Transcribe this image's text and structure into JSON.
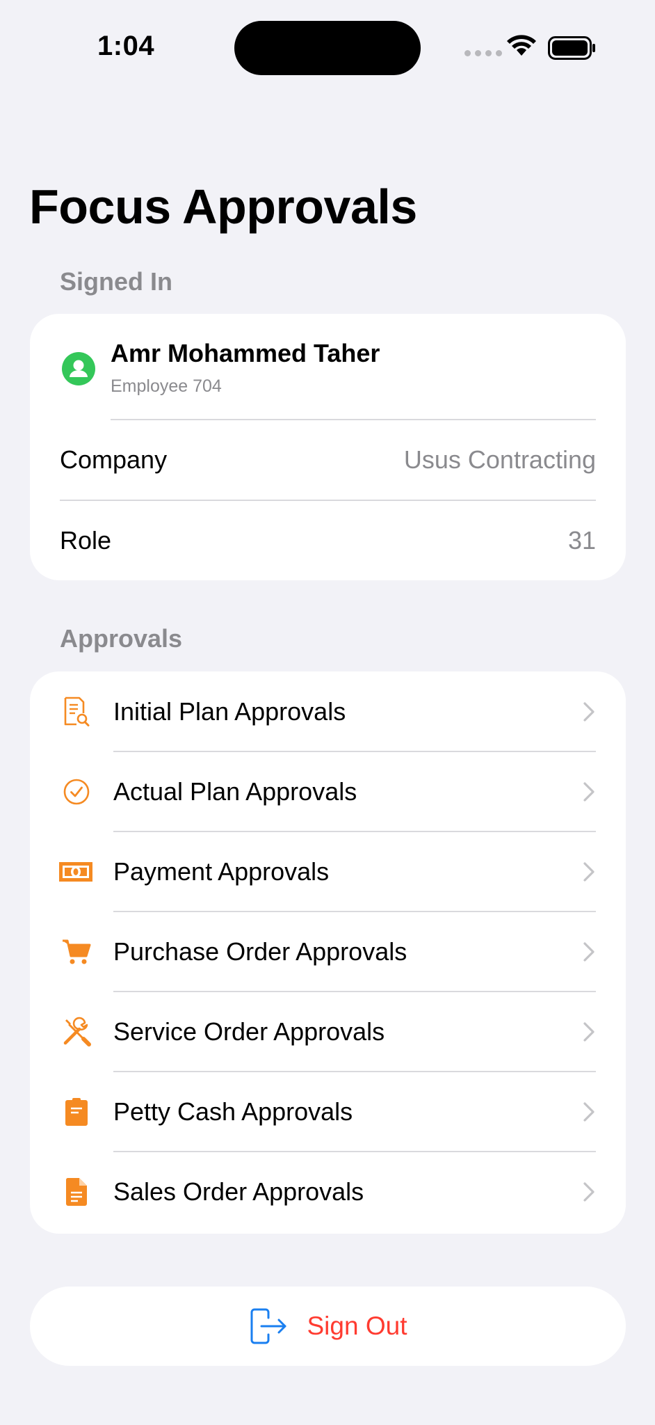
{
  "status_bar": {
    "time": "1:04"
  },
  "page": {
    "title": "Focus Approvals"
  },
  "signed_in": {
    "header": "Signed In",
    "user_name": "Amr Mohammed Taher",
    "employee": "Employee 704",
    "rows": [
      {
        "label": "Company",
        "value": "Usus Contracting"
      },
      {
        "label": "Role",
        "value": "31"
      }
    ]
  },
  "approvals": {
    "header": "Approvals",
    "items": [
      {
        "label": "Initial Plan Approvals",
        "icon": "document-search-icon"
      },
      {
        "label": "Actual Plan Approvals",
        "icon": "checkmark-circle-icon"
      },
      {
        "label": "Payment Approvals",
        "icon": "banknote-icon"
      },
      {
        "label": "Purchase Order Approvals",
        "icon": "cart-icon"
      },
      {
        "label": "Service Order Approvals",
        "icon": "wrench-screwdriver-icon"
      },
      {
        "label": "Petty Cash Approvals",
        "icon": "receipt-icon"
      },
      {
        "label": "Sales Order Approvals",
        "icon": "document-icon"
      }
    ]
  },
  "sign_out": {
    "label": "Sign Out"
  },
  "colors": {
    "accent_orange": "#f58a22",
    "avatar_green": "#34c759",
    "destructive_red": "#ff3b30",
    "link_blue": "#1a7ff0",
    "background": "#f2f2f7"
  }
}
